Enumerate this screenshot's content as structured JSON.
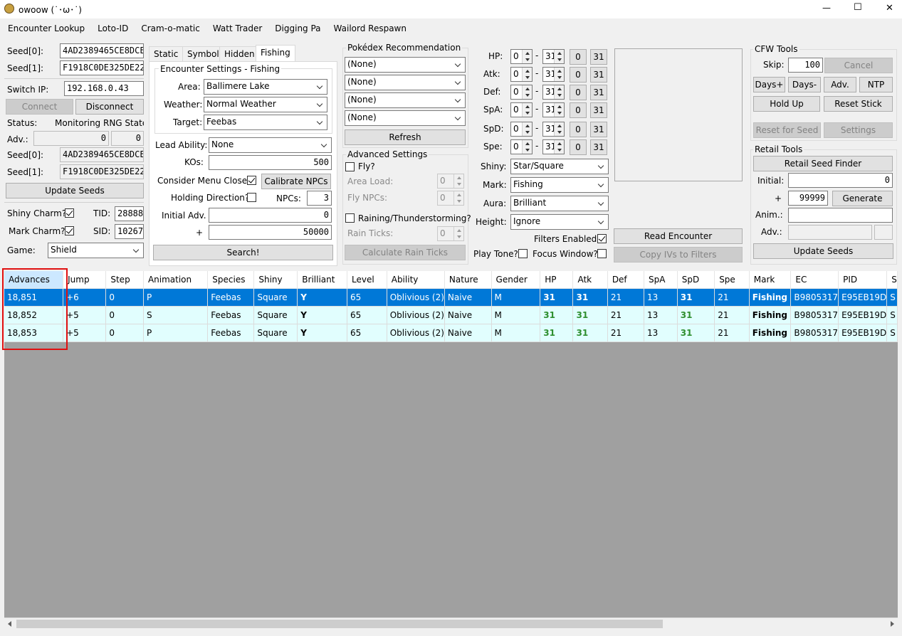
{
  "window": {
    "title": "owoow (˙･ω･˙)",
    "minimize": "—",
    "maximize": "☐",
    "close": "✕"
  },
  "menu": [
    "Encounter Lookup",
    "Loto-ID",
    "Cram-o-matic",
    "Watt Trader",
    "Digging Pa",
    "Wailord Respawn"
  ],
  "left": {
    "seed0_label": "Seed[0]:",
    "seed0": "4AD2389465CE8DCE",
    "seed1_label": "Seed[1]:",
    "seed1": "F1918C0DE325DE22",
    "switch_ip_label": "Switch IP:",
    "switch_ip": "192.168.0.43",
    "connect": "Connect",
    "disconnect": "Disconnect",
    "status_label": "Status:",
    "status": "Monitoring RNG State...",
    "adv_label": "Adv.:",
    "adv1": "0",
    "adv2": "0",
    "seed0b_label": "Seed[0]:",
    "seed0b": "4AD2389465CE8DCE",
    "seed1b_label": "Seed[1]:",
    "seed1b": "F1918C0DE325DE22",
    "update_seeds": "Update Seeds",
    "shiny_charm_label": "Shiny Charm?",
    "tid_label": "TID:",
    "tid": "28888",
    "mark_charm_label": "Mark Charm?",
    "sid_label": "SID:",
    "sid": "10267",
    "game_label": "Game:",
    "game": "Shield"
  },
  "tabs": [
    "Static",
    "Symbol",
    "Hidden",
    "Fishing"
  ],
  "encounter": {
    "group_title": "Encounter Settings - Fishing",
    "area_label": "Area:",
    "area": "Ballimere Lake",
    "weather_label": "Weather:",
    "weather": "Normal Weather",
    "target_label": "Target:",
    "target": "Feebas",
    "lead_label": "Lead Ability:",
    "lead": "None",
    "kos_label": "KOs:",
    "kos": "500",
    "menu_close_label": "Consider Menu Close?",
    "calibrate": "Calibrate NPCs",
    "holding_label": "Holding Direction?",
    "npcs_label": "NPCs:",
    "npcs": "3",
    "initial_label": "Initial Adv.",
    "initial": "0",
    "plus_label": "+",
    "plus": "50000",
    "search": "Search!"
  },
  "pokedex": {
    "title": "Pokédex Recommendation",
    "options": [
      "(None)",
      "(None)",
      "(None)",
      "(None)"
    ],
    "refresh": "Refresh"
  },
  "advanced": {
    "title": "Advanced Settings",
    "fly_label": "Fly?",
    "area_load_label": "Area Load:",
    "area_load": "0",
    "fly_npcs_label": "Fly NPCs:",
    "fly_npcs": "0",
    "raining_label": "Raining/Thunderstorming?",
    "rain_ticks_label": "Rain Ticks:",
    "rain_ticks": "0",
    "calc_rain": "Calculate Rain Ticks"
  },
  "ivs": [
    {
      "label": "HP:",
      "min": "0",
      "max": "31",
      "b0": "0",
      "b31": "31"
    },
    {
      "label": "Atk:",
      "min": "0",
      "max": "31",
      "b0": "0",
      "b31": "31"
    },
    {
      "label": "Def:",
      "min": "0",
      "max": "31",
      "b0": "0",
      "b31": "31"
    },
    {
      "label": "SpA:",
      "min": "0",
      "max": "31",
      "b0": "0",
      "b31": "31"
    },
    {
      "label": "SpD:",
      "min": "0",
      "max": "31",
      "b0": "0",
      "b31": "31"
    },
    {
      "label": "Spe:",
      "min": "0",
      "max": "31",
      "b0": "0",
      "b31": "31"
    }
  ],
  "iv_dash": "-",
  "filters": {
    "shiny_label": "Shiny:",
    "shiny": "Star/Square",
    "mark_label": "Mark:",
    "mark": "Fishing",
    "aura_label": "Aura:",
    "aura": "Brilliant",
    "height_label": "Height:",
    "height": "Ignore",
    "enabled_label": "Filters Enabled?",
    "play_tone_label": "Play Tone?",
    "focus_label": "Focus Window?"
  },
  "read_encounter": "Read Encounter",
  "copy_ivs": "Copy IVs to Filters",
  "cfw": {
    "title": "CFW Tools",
    "skip_label": "Skip:",
    "skip": "100",
    "cancel": "Cancel",
    "days_plus": "Days+",
    "days_minus": "Days-",
    "adv": "Adv.",
    "ntp": "NTP",
    "hold_up": "Hold Up",
    "reset_stick": "Reset Stick",
    "reset_for_seed": "Reset for Seed",
    "settings": "Settings"
  },
  "retail": {
    "title": "Retail Tools",
    "finder": "Retail Seed Finder",
    "initial_label": "Initial:",
    "initial": "0",
    "plus_label": "+",
    "plus": "99999",
    "generate": "Generate",
    "anim_label": "Anim.:",
    "anim": "",
    "adv_label": "Adv.:",
    "adv": "",
    "update_seeds": "Update Seeds"
  },
  "grid": {
    "columns": [
      "Advances",
      "Jump",
      "Step",
      "Animation",
      "Species",
      "Shiny",
      "Brilliant",
      "Level",
      "Ability",
      "Nature",
      "Gender",
      "HP",
      "Atk",
      "Def",
      "SpA",
      "SpD",
      "Spe",
      "Mark",
      "EC",
      "PID",
      "S"
    ],
    "rows": [
      [
        "18,851",
        "+6",
        "0",
        "P",
        "Feebas",
        "Square",
        "Y",
        "65",
        "Oblivious (2)",
        "Naive",
        "M",
        "31",
        "31",
        "21",
        "13",
        "31",
        "21",
        "Fishing",
        "B9805317",
        "E95EB19D",
        "S"
      ],
      [
        "18,852",
        "+5",
        "0",
        "S",
        "Feebas",
        "Square",
        "Y",
        "65",
        "Oblivious (2)",
        "Naive",
        "M",
        "31",
        "31",
        "21",
        "13",
        "31",
        "21",
        "Fishing",
        "B9805317",
        "E95EB19D",
        "S"
      ],
      [
        "18,853",
        "+5",
        "0",
        "P",
        "Feebas",
        "Square",
        "Y",
        "65",
        "Oblivious (2)",
        "Naive",
        "M",
        "31",
        "31",
        "21",
        "13",
        "31",
        "21",
        "Fishing",
        "B9805317",
        "E95EB19D",
        "S"
      ]
    ],
    "selected_row": 0
  },
  "colors": {
    "selection": "#0078d7",
    "row_bg": "#e1fefe",
    "iv_good": "#2f8f2f",
    "highlight_box": "#e01010"
  }
}
